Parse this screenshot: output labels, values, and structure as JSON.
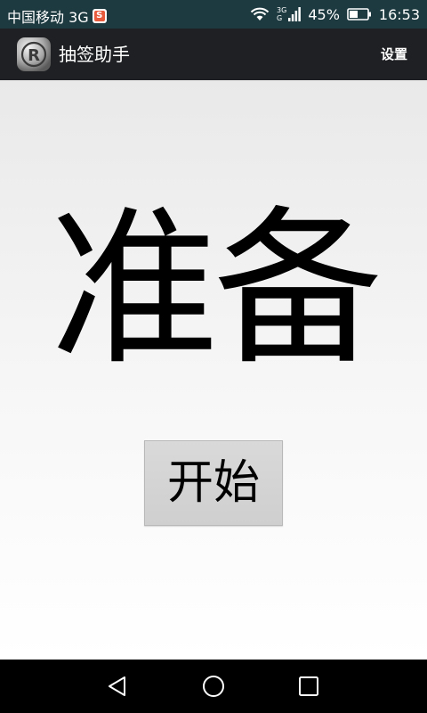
{
  "status_bar": {
    "carrier": "中国移动 3G",
    "network_top": "3G",
    "network_bottom": "G",
    "battery_percent": "45%",
    "time": "16:53"
  },
  "action_bar": {
    "title": "抽签助手",
    "settings_label": "设置",
    "logo_icon": "registered-trademark-icon"
  },
  "main": {
    "status_text": "准备",
    "start_label": "开始"
  },
  "nav_bar": {
    "back_icon": "back-triangle-icon",
    "home_icon": "home-circle-icon",
    "recent_icon": "recent-apps-square-icon"
  },
  "colors": {
    "status_bar_bg": "#1c3a40",
    "action_bar_bg": "#1f2023",
    "button_bg": "#d4d4d4",
    "nav_bar_bg": "#000000"
  }
}
